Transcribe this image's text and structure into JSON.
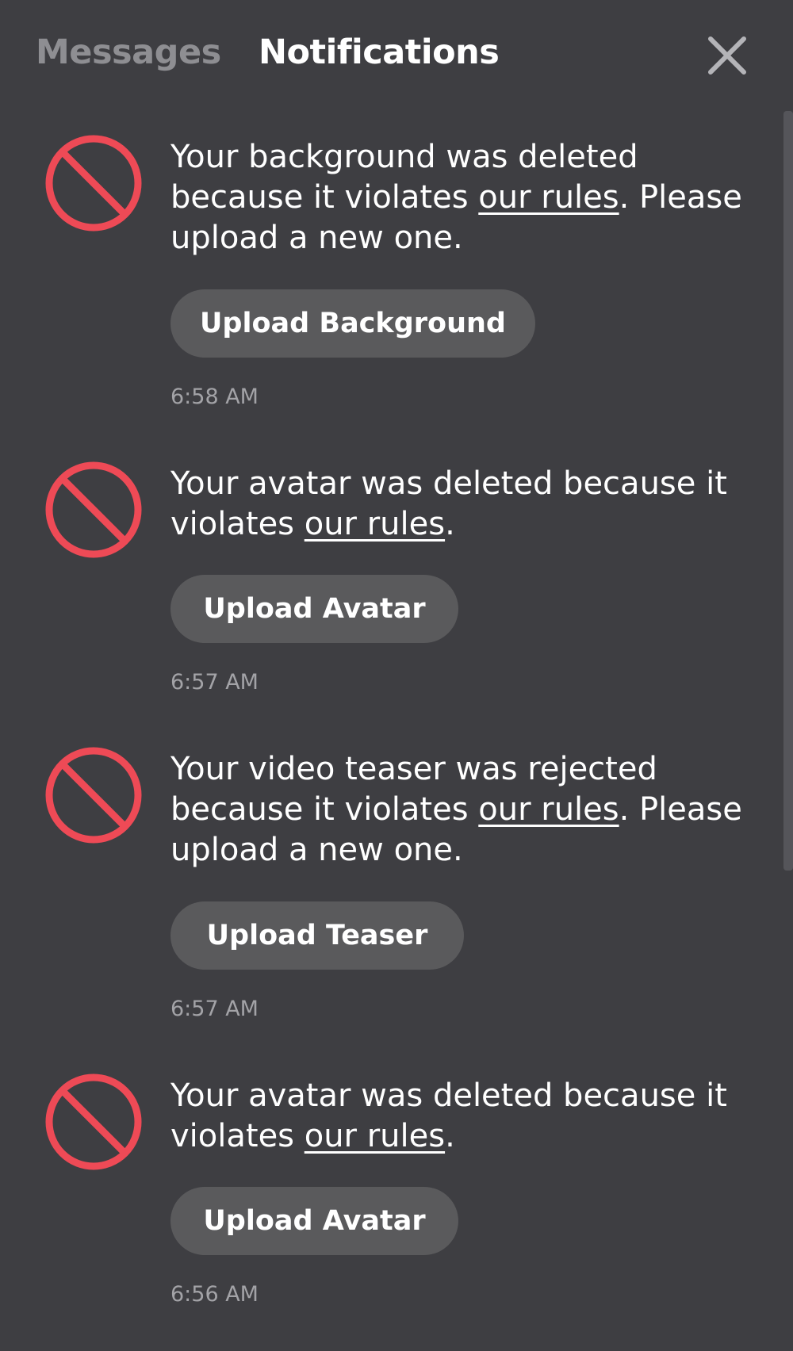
{
  "header": {
    "tabs": [
      {
        "label": "Messages",
        "active": false
      },
      {
        "label": "Notifications",
        "active": true
      }
    ],
    "close_icon": "close-icon"
  },
  "notifications": [
    {
      "icon": "block-icon",
      "text_before": "Your background was deleted because it violates ",
      "link_text": "our rules",
      "text_after": ". Please upload a new one.",
      "button_label": "Upload Background",
      "time": "6:58 AM"
    },
    {
      "icon": "block-icon",
      "text_before": "Your avatar was deleted because it violates ",
      "link_text": "our rules",
      "text_after": ".",
      "button_label": "Upload Avatar",
      "time": "6:57 AM"
    },
    {
      "icon": "block-icon",
      "text_before": "Your video teaser was rejected because it violates ",
      "link_text": "our rules",
      "text_after": ". Please upload a new one.",
      "button_label": "Upload Teaser",
      "time": "6:57 AM"
    },
    {
      "icon": "block-icon",
      "text_before": "Your avatar was deleted because it violates ",
      "link_text": "our rules",
      "text_after": ".",
      "button_label": "Upload Avatar",
      "time": "6:56 AM"
    }
  ],
  "colors": {
    "background": "#3e3e42",
    "block_icon": "#ee4a56",
    "button_bg": "#5a5a5c",
    "inactive_tab": "#8e8e92",
    "timestamp": "#a3a3a7"
  }
}
